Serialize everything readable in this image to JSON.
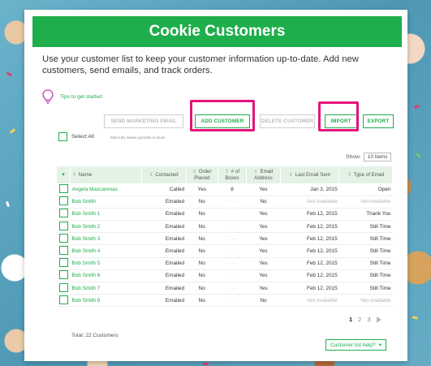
{
  "header": {
    "title": "Cookie Customers"
  },
  "intro_text": "Use your customer list to keep your customer information up-to-date. Add new customers, send emails, and track orders.",
  "tips": {
    "label": "Tips to get started",
    "icon": "lightbulb-icon"
  },
  "toolbar": {
    "send_marketing_email": "SEND MARKETING EMAIL",
    "add_customer": "ADD CUSTOMER",
    "delete_customer": "DELETE CUSTOMER",
    "import": "IMPORT",
    "export": "EXPORT"
  },
  "select_all": {
    "label": "Select All",
    "hint": "Select the names you'd like to email"
  },
  "show": {
    "label": "Show:",
    "value": "10 Items"
  },
  "table": {
    "columns": [
      "Name",
      "Contacted",
      "Order Placed",
      "# of Boxes",
      "Email Address",
      "Last Email Sent",
      "Type of Email"
    ],
    "rows": [
      {
        "name": "Angela Mascarenas",
        "contacted": "Called",
        "order": "Yes",
        "boxes": "8",
        "email": "Yes",
        "last": "Jan 3, 2015",
        "type": "Open"
      },
      {
        "name": "Bob Smith",
        "contacted": "Emailed",
        "order": "No",
        "boxes": "-",
        "email": "No",
        "last": "Not Available",
        "type": "Not Available"
      },
      {
        "name": "Bob Smith 1",
        "contacted": "Emailed",
        "order": "No",
        "boxes": "-",
        "email": "Yes",
        "last": "Feb 12, 2015",
        "type": "Thank You"
      },
      {
        "name": "Bob Smith 2",
        "contacted": "Emailed",
        "order": "No",
        "boxes": "-",
        "email": "Yes",
        "last": "Feb 12, 2015",
        "type": "Still Time"
      },
      {
        "name": "Bob Smith 3",
        "contacted": "Emailed",
        "order": "No",
        "boxes": "-",
        "email": "Yes",
        "last": "Feb 12, 2015",
        "type": "Still Time"
      },
      {
        "name": "Bob Smith 4",
        "contacted": "Emailed",
        "order": "No",
        "boxes": "-",
        "email": "Yes",
        "last": "Feb 12, 2015",
        "type": "Still Time"
      },
      {
        "name": "Bob Smith 5",
        "contacted": "Emailed",
        "order": "No",
        "boxes": "-",
        "email": "Yes",
        "last": "Feb 12, 2015",
        "type": "Still Time"
      },
      {
        "name": "Bob Smith 6",
        "contacted": "Emailed",
        "order": "No",
        "boxes": "-",
        "email": "Yes",
        "last": "Feb 12, 2015",
        "type": "Still Time"
      },
      {
        "name": "Bob Smith 7",
        "contacted": "Emailed",
        "order": "No",
        "boxes": "-",
        "email": "Yes",
        "last": "Feb 12, 2015",
        "type": "Still Time"
      },
      {
        "name": "Bob Smith 8",
        "contacted": "Emailed",
        "order": "No",
        "boxes": "-",
        "email": "No",
        "last": "Not Available",
        "type": "Not Available"
      }
    ]
  },
  "pagination": {
    "pages": [
      "1",
      "2",
      "3"
    ],
    "current": "1"
  },
  "total": "Total: 22 Customers",
  "help": {
    "label": "Customer list help?"
  },
  "colors": {
    "brand": "#1eae4b",
    "highlight": "#e5147a",
    "header_row": "#e4f2e6",
    "tips_icon": "#c03cb8"
  }
}
